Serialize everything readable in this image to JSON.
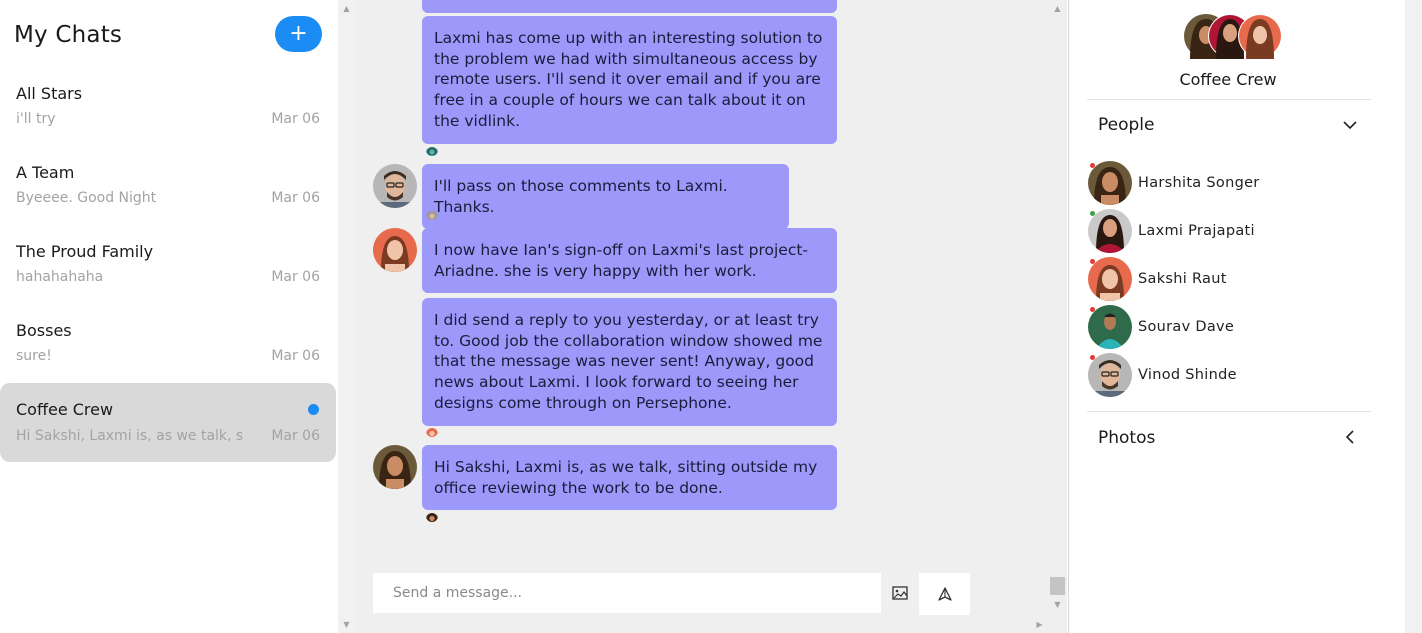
{
  "left": {
    "title": "My Chats",
    "new_chat_label": "+",
    "chats": [
      {
        "name": "All Stars",
        "preview": "i'll try",
        "date": "Mar 06"
      },
      {
        "name": "A Team",
        "preview": "Byeeee. Good Night",
        "date": "Mar 06"
      },
      {
        "name": "The Proud Family",
        "preview": "hahahahaha",
        "date": "Mar 06"
      },
      {
        "name": "Bosses",
        "preview": "sure!",
        "date": "Mar 06"
      },
      {
        "name": "Coffee Crew",
        "preview": "Hi Sakshi, Laxmi is, as we talk, sitting outside my",
        "date": "Mar 06"
      }
    ]
  },
  "messages": [
    {
      "text": "Laxmi has come up with an interesting solution to the problem we had with simultaneous access by remote users. I'll send it over email and if you are free in a couple of hours we can talk about it on the vidlink."
    },
    {
      "text": "I'll pass on those comments to Laxmi. Thanks."
    },
    {
      "text": "I now have Ian's sign-off on Laxmi's last project-Ariadne. she is very happy with her work."
    },
    {
      "text": "I did send a reply to you yesterday, or at least try to. Good job the collaboration window showed me that the message was never sent! Anyway, good news about Laxmi. I look forward to seeing her designs come through on Persephone."
    },
    {
      "text": "Hi Sakshi, Laxmi is, as we talk, sitting outside my office reviewing the work to be done."
    }
  ],
  "compose": {
    "placeholder": "Send a message..."
  },
  "details": {
    "group_name": "Coffee Crew",
    "people_title": "People",
    "photos_title": "Photos",
    "people": [
      {
        "name": "Harshita Songer",
        "status_color": "#e53935"
      },
      {
        "name": "Laxmi Prajapati",
        "status_color": "#43a047"
      },
      {
        "name": "Sakshi Raut",
        "status_color": "#e53935"
      },
      {
        "name": "Sourav Dave",
        "status_color": "#e53935"
      },
      {
        "name": "Vinod Shinde",
        "status_color": "#e53935"
      }
    ]
  },
  "colors": {
    "accent": "#1b8cf3",
    "bubble": "#9c99fb",
    "active_chat": "#d9d9d9"
  }
}
